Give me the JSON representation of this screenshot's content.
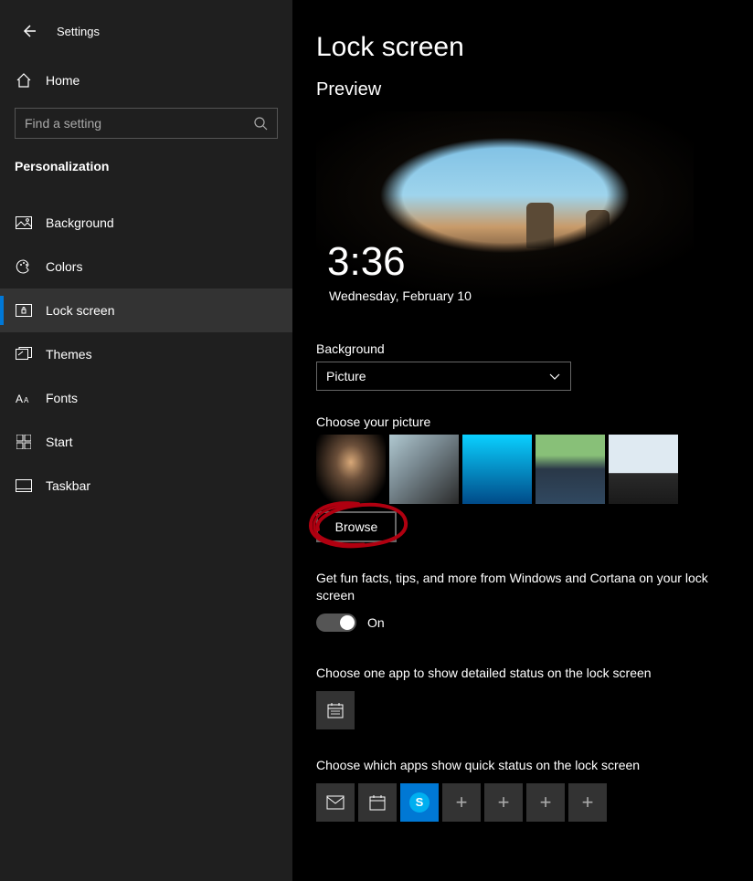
{
  "header": {
    "title": "Settings"
  },
  "home": {
    "label": "Home"
  },
  "search": {
    "placeholder": "Find a setting"
  },
  "section": "Personalization",
  "nav": [
    {
      "label": "Background"
    },
    {
      "label": "Colors"
    },
    {
      "label": "Lock screen"
    },
    {
      "label": "Themes"
    },
    {
      "label": "Fonts"
    },
    {
      "label": "Start"
    },
    {
      "label": "Taskbar"
    }
  ],
  "main": {
    "title": "Lock screen",
    "preview_heading": "Preview",
    "preview_time": "3:36",
    "preview_date": "Wednesday, February 10",
    "background_label": "Background",
    "background_value": "Picture",
    "choose_picture_label": "Choose your picture",
    "browse_label": "Browse",
    "funfacts_text": "Get fun facts, tips, and more from Windows and Cortana on your lock screen",
    "funfacts_state": "On",
    "detailed_status_label": "Choose one app to show detailed status on the lock screen",
    "quick_status_label": "Choose which apps show quick status on the lock screen"
  }
}
